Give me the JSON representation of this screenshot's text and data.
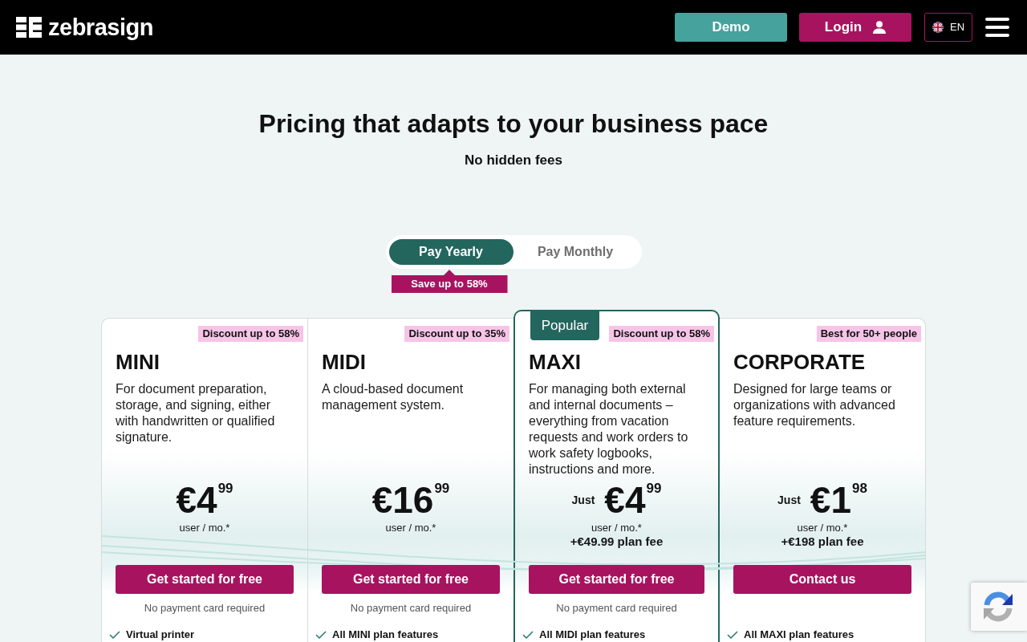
{
  "header": {
    "brand": "zebrasign",
    "buttons": [
      {
        "label": "Demo",
        "kind": "plain"
      },
      {
        "label": "Login",
        "kind": "account"
      }
    ],
    "language": "EN"
  },
  "hero": {
    "title": "Pricing that adapts to your business pace",
    "subtitle": "No hidden fees"
  },
  "billing": {
    "options": [
      {
        "label": "Pay Yearly",
        "selected": true
      },
      {
        "label": "Pay Monthly",
        "selected": false
      }
    ],
    "savings_note": "Save up to 58%"
  },
  "plans": [
    {
      "tag": "Discount up to 58%",
      "name": "MINI",
      "highlighted": false,
      "description": "For document preparation, storage, and signing, either with handwritten or qualified signature.",
      "price": {
        "amount": "€4",
        "cents": "99",
        "unit": "user / mo.*"
      },
      "cta": "Get started for free",
      "note": "No payment card required",
      "features": [
        "Virtual printer"
      ]
    },
    {
      "tag": "Discount up to 35%",
      "name": "MIDI",
      "highlighted": false,
      "description": "A cloud-based document management system.",
      "price": {
        "amount": "€16",
        "cents": "99",
        "unit": "user / mo.*"
      },
      "cta": "Get started for free",
      "note": "No payment card required",
      "features": [
        "All MINI plan features"
      ]
    },
    {
      "ribbon": "Popular",
      "tag": "Discount up to 58%",
      "name": "MAXI",
      "highlighted": true,
      "description": "For managing both external and internal documents – everything from vacation requests and work orders to work safety logbooks, instructions and more.",
      "price": {
        "prefix": "Just",
        "amount": "€4",
        "cents": "99",
        "unit": "user / mo.*",
        "plan_fee": "+€49.99 plan fee"
      },
      "cta": "Get started for free",
      "note": "No payment card required",
      "features": [
        "All MIDI plan features"
      ]
    },
    {
      "tag": "Best for 50+ people",
      "name": "CORPORATE",
      "highlighted": false,
      "description": "Designed for large teams or organizations with advanced feature requirements.",
      "price": {
        "prefix": "Just",
        "amount": "€1",
        "cents": "98",
        "unit": "user / mo.*",
        "plan_fee": "+€198 plan fee"
      },
      "cta": "Contact us",
      "features": [
        "All MAXI plan features"
      ]
    }
  ]
}
